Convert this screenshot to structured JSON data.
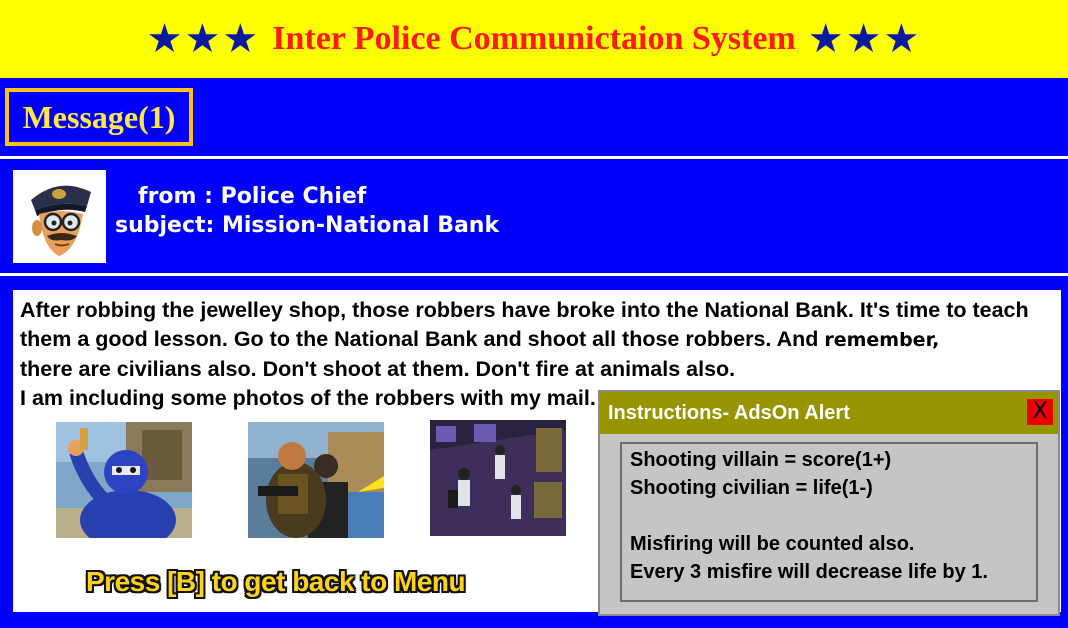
{
  "header": {
    "title": "Inter Police Communictaion System",
    "stars_left": "★★★",
    "stars_right": "★★★"
  },
  "tab": {
    "label": "Message(1)"
  },
  "message": {
    "from": "from : Police Chief",
    "subject": "subject: Mission-National Bank",
    "body_lines": [
      "After robbing the jewelley shop, those robbers have broke into the National Bank. It's time to teach",
      "them a good lesson. Go to the National Bank and shoot all those robbers.  And",
      "remember,",
      "there are civilians also. Don't shoot at them. Don't fire at animals also.",
      "I am including some photos of the robbers with my mail."
    ]
  },
  "photos": [
    "robber-photo-blue-mask",
    "robber-photo-gunman",
    "robber-photo-group"
  ],
  "footer": {
    "press_hint": "Press [B] to get back to Menu"
  },
  "dialog": {
    "title": "Instructions- AdsOn Alert",
    "close_label": "X",
    "lines": [
      "Shooting villain = score(1+)",
      "Shooting civilian = life(1-)",
      "Misfiring will be counted also.",
      "Every 3 misfire will decrease life by 1."
    ]
  },
  "colors": {
    "background": "#0000ff",
    "header_bar": "#ffff00",
    "title_text": "#ff1a1a",
    "stars": "#0a1aa0",
    "tab_border": "#ffc21a",
    "press_hint": "#ffd21a",
    "dialog_title_bar": "#989400",
    "close_button": "#ee0000"
  }
}
